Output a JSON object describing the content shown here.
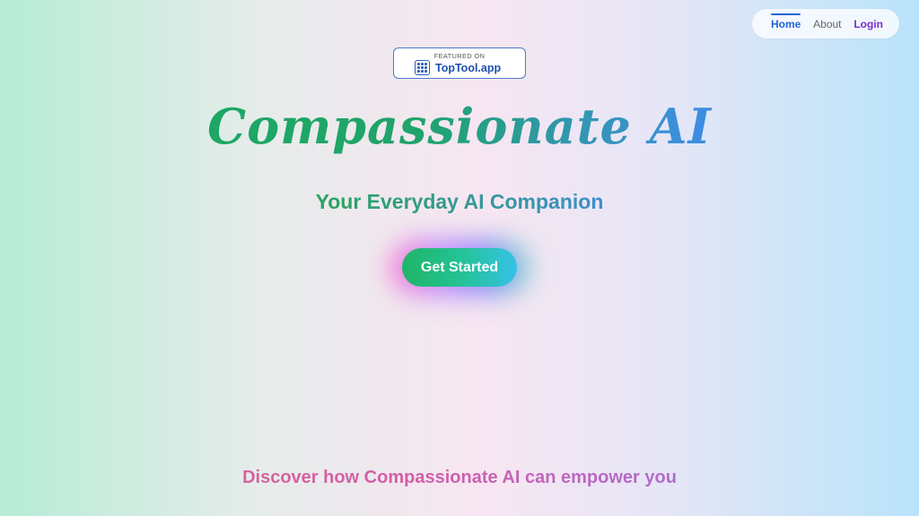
{
  "nav": {
    "home": "Home",
    "about": "About",
    "login": "Login"
  },
  "badge": {
    "featured": "FEATURED ON",
    "name": "TopTool.app",
    "icon": "grid-icon"
  },
  "hero": {
    "title": "Compassionate AI",
    "subtitle": "Your Everyday AI Companion",
    "cta_label": "Get Started"
  },
  "footer": {
    "discover": "Discover how Compassionate AI can empower you"
  },
  "colors": {
    "accent_green": "#1fb566",
    "accent_blue": "#3a7ad8",
    "nav_active": "#1f66d6",
    "login": "#7a2ccc"
  }
}
